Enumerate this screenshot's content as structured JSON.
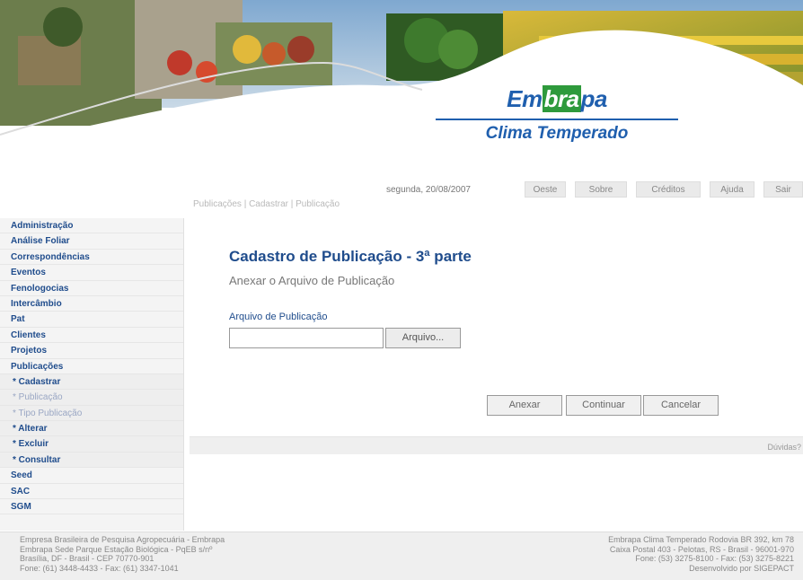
{
  "header": {
    "logo_text_1": "Em",
    "logo_text_2": "bra",
    "logo_text_3": "pa",
    "logo_subtitle": "Clima Temperado"
  },
  "topbar": {
    "date": "segunda, 20/08/2007",
    "nav": [
      "Oeste",
      "Sobre",
      "Créditos",
      "Ajuda",
      "Sair"
    ]
  },
  "breadcrumb": "Publicações | Cadastrar | Publicação",
  "sidebar": {
    "items": [
      {
        "label": "Administração",
        "type": "main"
      },
      {
        "label": "Análise Foliar",
        "type": "main"
      },
      {
        "label": "Correspondências",
        "type": "main"
      },
      {
        "label": "Eventos",
        "type": "main"
      },
      {
        "label": "Fenologocias",
        "type": "main"
      },
      {
        "label": "Intercâmbio",
        "type": "main"
      },
      {
        "label": "Pat",
        "type": "main"
      },
      {
        "label": "Clientes",
        "type": "main"
      },
      {
        "label": "Projetos",
        "type": "main"
      },
      {
        "label": "Publicações",
        "type": "main"
      },
      {
        "label": "* Cadastrar",
        "type": "sub"
      },
      {
        "label": "* Publicação",
        "type": "sub-dim"
      },
      {
        "label": "* Tipo Publicação",
        "type": "sub-dim"
      },
      {
        "label": "* Alterar",
        "type": "sub"
      },
      {
        "label": "* Excluir",
        "type": "sub"
      },
      {
        "label": "* Consultar",
        "type": "sub"
      },
      {
        "label": "Seed",
        "type": "main"
      },
      {
        "label": "SAC",
        "type": "main"
      },
      {
        "label": "SGM",
        "type": "main"
      }
    ]
  },
  "main": {
    "title": "Cadastro de Publicação - 3ª parte",
    "subtitle": "Anexar o Arquivo de Publicação",
    "file_label": "Arquivo de Publicação",
    "file_value": "",
    "browse_button": "Arquivo...",
    "actions": [
      "Anexar",
      "Continuar",
      "Cancelar"
    ],
    "band_link": "Dúvidas?"
  },
  "footer": {
    "left": [
      "Empresa Brasileira de Pesquisa Agropecuária - Embrapa",
      "Embrapa Sede Parque Estação Biológica - PqEB s/nº",
      "Brasília, DF - Brasil - CEP 70770-901",
      "Fone: (61) 3448-4433 - Fax: (61) 3347-1041"
    ],
    "right": [
      "Embrapa Clima Temperado Rodovia BR 392, km 78",
      "Caixa Postal 403 - Pelotas, RS - Brasil - 96001-970",
      "Fone: (53) 3275-8100 - Fax: (53) 3275-8221",
      "Desenvolvido por SIGEPACT"
    ]
  }
}
